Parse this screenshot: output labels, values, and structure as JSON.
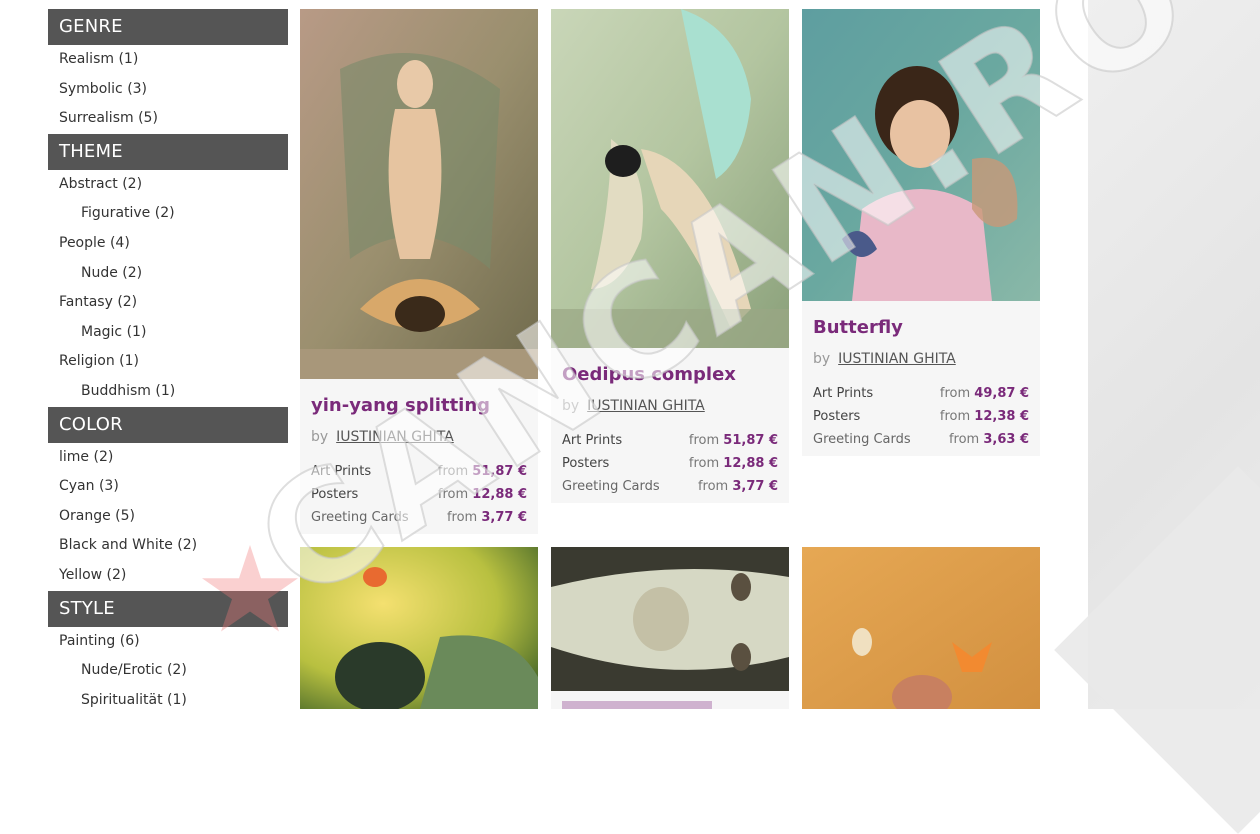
{
  "sidebar": {
    "sections": [
      {
        "title": "GENRE",
        "items": [
          {
            "label": "Realism (1)",
            "sub": false
          },
          {
            "label": "Symbolic (3)",
            "sub": false
          },
          {
            "label": "Surrealism (5)",
            "sub": false
          }
        ]
      },
      {
        "title": "THEME",
        "items": [
          {
            "label": "Abstract (2)",
            "sub": false
          },
          {
            "label": "Figurative (2)",
            "sub": true
          },
          {
            "label": "People (4)",
            "sub": false
          },
          {
            "label": "Nude (2)",
            "sub": true
          },
          {
            "label": "Fantasy (2)",
            "sub": false
          },
          {
            "label": "Magic (1)",
            "sub": true
          },
          {
            "label": "Religion (1)",
            "sub": false
          },
          {
            "label": "Buddhism (1)",
            "sub": true
          }
        ]
      },
      {
        "title": "COLOR",
        "items": [
          {
            "label": "lime (2)",
            "sub": false
          },
          {
            "label": "Cyan (3)",
            "sub": false
          },
          {
            "label": "Orange (5)",
            "sub": false
          },
          {
            "label": "Black and White (2)",
            "sub": false
          },
          {
            "label": "Yellow (2)",
            "sub": false
          }
        ]
      },
      {
        "title": "STYLE",
        "items": [
          {
            "label": "Painting (6)",
            "sub": false
          },
          {
            "label": "Nude/Erotic (2)",
            "sub": true
          },
          {
            "label": "Spiritualität (1)",
            "sub": true
          }
        ]
      }
    ]
  },
  "cards": [
    {
      "title": "yin-yang splitting",
      "by": "by",
      "artist": "IUSTINIAN GHITA",
      "prices": [
        {
          "label": "Art Prints",
          "from": "from",
          "value": "51,87 €"
        },
        {
          "label": "Posters",
          "from": "from",
          "value": "12,88 €"
        },
        {
          "label": "Greeting Cards",
          "from": "from",
          "value": "3,77 €"
        }
      ]
    },
    {
      "title": "Oedipus complex",
      "by": "by",
      "artist": "IUSTINIAN GHITA",
      "prices": [
        {
          "label": "Art Prints",
          "from": "from",
          "value": "51,87 €"
        },
        {
          "label": "Posters",
          "from": "from",
          "value": "12,88 €"
        },
        {
          "label": "Greeting Cards",
          "from": "from",
          "value": "3,77 €"
        }
      ]
    },
    {
      "title": "Butterfly",
      "by": "by",
      "artist": "IUSTINIAN GHITA",
      "prices": [
        {
          "label": "Art Prints",
          "from": "from",
          "value": "49,87 €"
        },
        {
          "label": "Posters",
          "from": "from",
          "value": "12,38 €"
        },
        {
          "label": "Greeting Cards",
          "from": "from",
          "value": "3,63 €"
        }
      ]
    }
  ],
  "watermark": {
    "text": "CANCAN.RO"
  },
  "colors": {
    "accent": "#7a2a7a",
    "section_header": "#555555"
  }
}
